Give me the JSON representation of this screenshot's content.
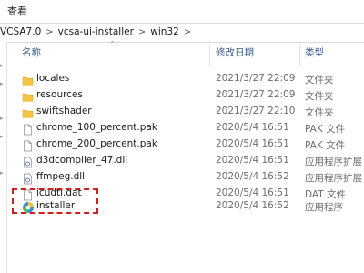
{
  "ribbon": {
    "tab": "查看"
  },
  "breadcrumb": [
    "VCSA7.0",
    "vcsa-ui-installer",
    "win32"
  ],
  "columns": {
    "name": "名称",
    "date": "修改日期",
    "type": "类型"
  },
  "files": [
    {
      "name": "locales",
      "date": "2021/3/27 22:09",
      "type": "文件夹",
      "icon": "folder-icon"
    },
    {
      "name": "resources",
      "date": "2021/3/27 22:09",
      "type": "文件夹",
      "icon": "folder-icon"
    },
    {
      "name": "swiftshader",
      "date": "2021/3/27 22:10",
      "type": "文件夹",
      "icon": "folder-icon"
    },
    {
      "name": "chrome_100_percent.pak",
      "date": "2020/5/4 16:51",
      "type": "PAK 文件",
      "icon": "file-icon"
    },
    {
      "name": "chrome_200_percent.pak",
      "date": "2020/5/4 16:51",
      "type": "PAK 文件",
      "icon": "file-icon"
    },
    {
      "name": "d3dcompiler_47.dll",
      "date": "2020/5/4 16:51",
      "type": "应用程序扩展",
      "icon": "dll-file-icon"
    },
    {
      "name": "ffmpeg.dll",
      "date": "2020/5/4 16:52",
      "type": "应用程序扩展",
      "icon": "dll-file-icon"
    },
    {
      "name": "icudtl.dat",
      "date": "2020/5/4 16:51",
      "type": "DAT 文件",
      "icon": "file-icon"
    },
    {
      "name": "installer",
      "date": "2020/5/4 16:52",
      "type": "应用程序",
      "icon": "installer-app-icon"
    }
  ],
  "colors": {
    "folder": "#f5c542",
    "highlight": "#cc1f1f",
    "header_text": "#3b5a8a"
  }
}
